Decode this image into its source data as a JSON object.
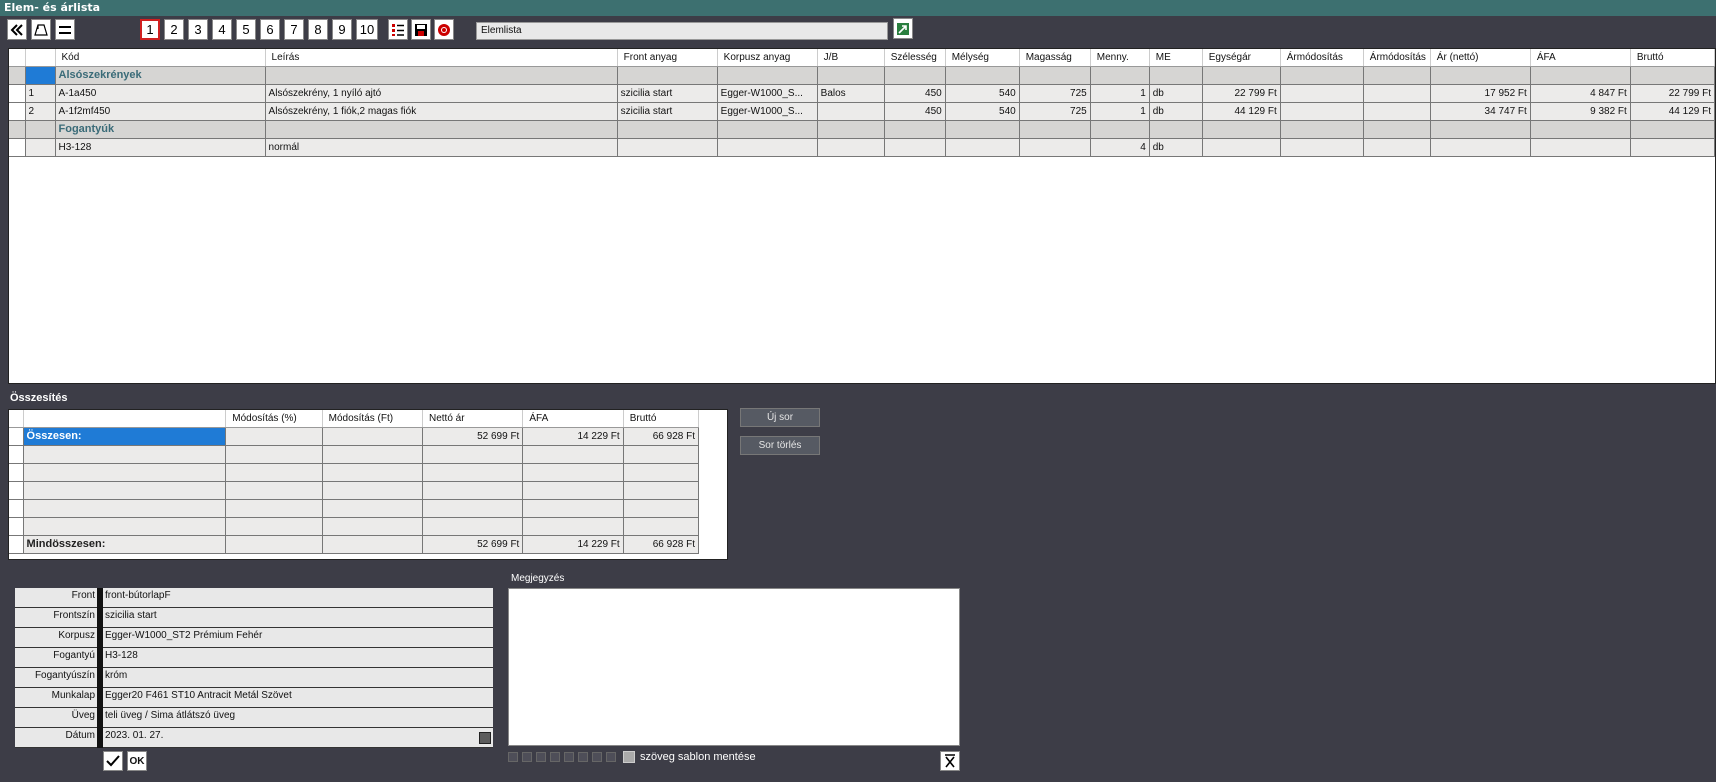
{
  "window": {
    "title": "Elem- és árlista"
  },
  "toolbar": {
    "pages": [
      "1",
      "2",
      "3",
      "4",
      "5",
      "6",
      "7",
      "8",
      "9",
      "10"
    ],
    "active_page": "1",
    "list_name": "Elemlista"
  },
  "grid": {
    "columns": [
      "Kód",
      "Leírás",
      "Front anyag",
      "Korpusz anyag",
      "J/B",
      "Szélesség",
      "Mélység",
      "Magasság",
      "Menny.",
      "ME",
      "Egységár",
      "Ármódosítás",
      "Ármódosítás",
      "Ár (nettó)",
      "ÁFA",
      "Bruttó"
    ],
    "rows": [
      {
        "type": "group",
        "num": "",
        "cells": [
          "Alsószekrények",
          "",
          "",
          "",
          "",
          "",
          "",
          "",
          "",
          "",
          "",
          "",
          "",
          "",
          "",
          ""
        ]
      },
      {
        "type": "item",
        "num": "1",
        "cells": [
          "A-1a450",
          "Alsószekrény, 1 nyíló ajtó",
          "szicilia start",
          "Egger-W1000_S...",
          "Balos",
          "450",
          "540",
          "725",
          "1",
          "db",
          "22 799 Ft",
          "",
          "",
          "17 952 Ft",
          "4 847 Ft",
          "22 799 Ft"
        ]
      },
      {
        "type": "item",
        "num": "2",
        "cells": [
          "A-1f2mf450",
          "Alsószekrény, 1 fiók,2 magas fiók",
          "szicilia start",
          "Egger-W1000_S...",
          "",
          "450",
          "540",
          "725",
          "1",
          "db",
          "44 129 Ft",
          "",
          "",
          "34 747 Ft",
          "9 382 Ft",
          "44 129 Ft"
        ]
      },
      {
        "type": "group",
        "num": "",
        "cells": [
          "Fogantyúk",
          "",
          "",
          "",
          "",
          "",
          "",
          "",
          "",
          "",
          "",
          "",
          "",
          "",
          "",
          ""
        ]
      },
      {
        "type": "item",
        "num": "",
        "cells": [
          "H3-128",
          "normál",
          "",
          "",
          "",
          "",
          "",
          "",
          "4",
          "db",
          "",
          "",
          "",
          "",
          "",
          ""
        ]
      }
    ]
  },
  "summary": {
    "title": "Összesítés",
    "columns": [
      "",
      "Módosítás (%)",
      "Módosítás (Ft)",
      "Nettó ár",
      "ÁFA",
      "Bruttó"
    ],
    "total_label": "Összesen:",
    "total": [
      "",
      "",
      "52 699 Ft",
      "14 229 Ft",
      "66 928 Ft"
    ],
    "grand_label": "Mindösszesen:",
    "grand": [
      "",
      "",
      "52 699 Ft",
      "14 229 Ft",
      "66 928 Ft"
    ]
  },
  "buttons": {
    "new_row": "Új sor",
    "delete_row": "Sor törlés",
    "ok": "OK"
  },
  "properties": [
    {
      "key": "Front",
      "value": "front-bútorlapF"
    },
    {
      "key": "Frontszín",
      "value": "szicilia start"
    },
    {
      "key": "Korpusz",
      "value": "Egger-W1000_ST2 Prémium Fehér"
    },
    {
      "key": "Fogantyú",
      "value": "H3-128"
    },
    {
      "key": "Fogantyúszín",
      "value": "króm"
    },
    {
      "key": "Munkalap",
      "value": "Egger20 F461 ST10 Antracit Metál Szövet"
    },
    {
      "key": "Üveg",
      "value": "teli üveg / Sima átlátszó üveg"
    },
    {
      "key": "Dátum",
      "value": "2023. 01. 27."
    }
  ],
  "note": {
    "label": "Megjegyzés",
    "value": "",
    "save_template": "szöveg sablon mentése"
  },
  "colors": {
    "titlebar": "#3d7070",
    "background": "#3d3d47",
    "selection": "#1f7bd6",
    "group_text": "#3a6b78"
  }
}
